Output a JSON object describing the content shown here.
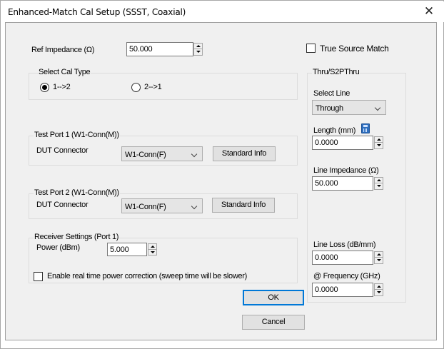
{
  "window": {
    "title": "Enhanced-Match Cal Setup (SSST, Coaxial)",
    "close_glyph": "✕"
  },
  "ref_impedance": {
    "label": "Ref Impedance (Ω)",
    "value": "50.000"
  },
  "true_source_match": {
    "label": "True Source Match",
    "checked": false
  },
  "cal_type": {
    "legend": "Select Cal Type",
    "options": [
      {
        "label": "1-->2",
        "selected": true
      },
      {
        "label": "2-->1",
        "selected": false
      }
    ]
  },
  "test_port_1": {
    "legend": "Test Port 1 (W1-Conn(M))",
    "dut_label": "DUT Connector",
    "connector": "W1-Conn(F)",
    "info_button": "Standard Info"
  },
  "test_port_2": {
    "legend": "Test Port 2 (W1-Conn(M))",
    "dut_label": "DUT Connector",
    "connector": "W1-Conn(F)",
    "info_button": "Standard Info"
  },
  "receiver": {
    "legend": "Receiver Settings (Port 1)",
    "power_label": "Power (dBm)",
    "power_value": "5.000"
  },
  "power_correction": {
    "label": "Enable real time power correction (sweep time will be slower)",
    "checked": false
  },
  "thru": {
    "legend": "Thru/S2PThru",
    "select_line_label": "Select Line",
    "select_line_value": "Through",
    "length_label": "Length (mm)",
    "length_value": "0.0000",
    "line_impedance_label": "Line Impedance (Ω)",
    "line_impedance_value": "50.000",
    "line_loss_label": "Line Loss (dB/mm)",
    "line_loss_value": "0.0000",
    "frequency_label": "@ Frequency (GHz)",
    "frequency_value": "0.0000"
  },
  "buttons": {
    "ok": "OK",
    "cancel": "Cancel"
  },
  "colors": {
    "dialog_bg": "#f0f0f0",
    "default_button_border": "#0078d7",
    "calculator_icon": "#2e6fbf"
  }
}
